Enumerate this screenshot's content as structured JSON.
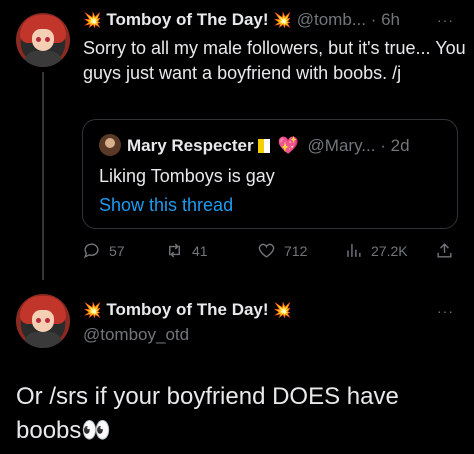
{
  "tweet": {
    "display_name": "Tomboy of The Day!",
    "handle": "@tomb...",
    "time": "6h",
    "more": "···",
    "text": "Sorry to all my male followers, but it's true... You guys just want a boyfriend with boobs. /j",
    "quote": {
      "display_name": "Mary Respecter",
      "handle": "@Mary...",
      "time": "2d",
      "text": "Liking Tomboys is gay",
      "link": "Show this thread"
    },
    "actions": {
      "replies": "57",
      "retweets": "41",
      "likes": "712",
      "views": "27.2K"
    }
  },
  "reply": {
    "display_name": "Tomboy of The Day!",
    "handle": "@tomboy_otd",
    "more": "···",
    "text": "Or /srs if your boyfriend DOES have boobs👀"
  },
  "icons": {
    "sparkle": "💥",
    "heart_emoji": "💖",
    "eyes": "👀"
  }
}
